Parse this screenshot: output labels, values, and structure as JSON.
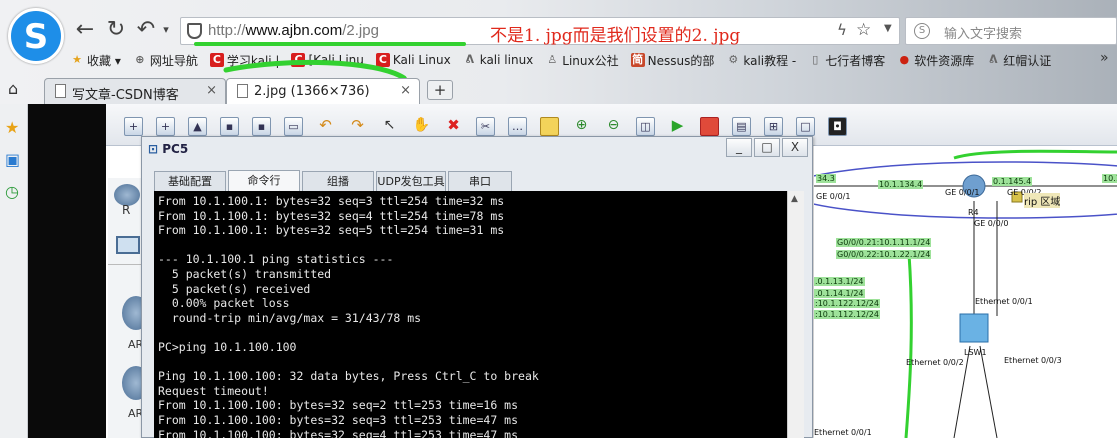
{
  "browser": {
    "logo_glyph": "S",
    "nav": {
      "back": "←",
      "refresh": "↻",
      "undo": "↶",
      "dropdown": "▾"
    },
    "address": {
      "url_scheme": "http://",
      "url_host": "www.ajbn.com",
      "url_path": "/2.jpg"
    },
    "annotation": "不是1. jpg而是我们设置的2. jpg",
    "search": {
      "icon": "S",
      "placeholder": "输入文字搜索"
    },
    "bookmarks": [
      {
        "icon": "star",
        "label": "收藏 ▾"
      },
      {
        "icon": "globe",
        "label": "网址导航"
      },
      {
        "icon": "C",
        "label": "学习kali |"
      },
      {
        "icon": "C",
        "label": "[Kali Linu"
      },
      {
        "icon": "C",
        "label": "Kali Linux"
      },
      {
        "icon": "A",
        "label": "kali linux"
      },
      {
        "icon": "penguin",
        "label": "Linux公社"
      },
      {
        "icon": "N",
        "label": "Nessus的部"
      },
      {
        "icon": "gear",
        "label": "kali教程 -"
      },
      {
        "icon": "page",
        "label": "七行者博客"
      },
      {
        "icon": "red",
        "label": "软件资源库"
      },
      {
        "icon": "A",
        "label": "红帽认证"
      }
    ],
    "tabs": [
      {
        "title": "写文章-CSDN博客",
        "close": "×"
      },
      {
        "title": "2.jpg (1366×736)",
        "close": "×"
      }
    ],
    "newtab": "+"
  },
  "ensp": {
    "toolbar_icons": [
      "new",
      "add",
      "open",
      "save",
      "save-as",
      "print",
      "undo",
      "redo",
      "select",
      "hand",
      "delete",
      "remove-link",
      "text",
      "rectangle",
      "zoom-in",
      "zoom-out",
      "fit",
      "start",
      "stop",
      "capture",
      "topology",
      "palette",
      "snapshot"
    ],
    "pc_window": {
      "title": "PC5",
      "buttons": {
        "min": "_",
        "max": "□",
        "close": "X"
      },
      "tabs": [
        "基础配置",
        "命令行",
        "组播",
        "UDP发包工具",
        "串口"
      ],
      "active_tab": "命令行",
      "terminal_lines": [
        "From 10.1.100.1: bytes=32 seq=3 ttl=254 time=32 ms",
        "From 10.1.100.1: bytes=32 seq=4 ttl=254 time=78 ms",
        "From 10.1.100.1: bytes=32 seq=5 ttl=254 time=31 ms",
        "",
        "--- 10.1.100.1 ping statistics ---",
        "  5 packet(s) transmitted",
        "  5 packet(s) received",
        "  0.00% packet loss",
        "  round-trip min/avg/max = 31/43/78 ms",
        "",
        "PC>ping 10.1.100.100",
        "",
        "Ping 10.1.100.100: 32 data bytes, Press Ctrl_C to break",
        "Request timeout!",
        "From 10.1.100.100: bytes=32 seq=2 ttl=253 time=16 ms",
        "From 10.1.100.100: bytes=32 seq=3 ttl=253 time=47 ms",
        "From 10.1.100.100: bytes=32 seq=4 ttl=253 time=47 ms"
      ]
    },
    "device_labels": [
      "R",
      "AR",
      "AR"
    ],
    "topology": {
      "green_labels": [
        "34.3",
        "10.1.134.4",
        "0.1.145.4",
        "10.1",
        "G0/0/0.21:10.1.11.1/24",
        "G0/0/0.22:10.1.22.1/24",
        ".0.1.13.1/24",
        ".0.1.14.1/24",
        ":10.1.122.12/24",
        ":10.1.112.12/24"
      ],
      "labels": [
        "GE 0/0/1",
        "GE 0/0/1",
        "GE 0/0/2",
        "R4",
        "GE 0/0/0",
        "Ethernet 0/0/1",
        "LSW1",
        "Ethernet 0/0/2",
        "Ethernet 0/0/3",
        "Ethernet 0/0/1"
      ],
      "rip_label": "rip 区域"
    }
  }
}
